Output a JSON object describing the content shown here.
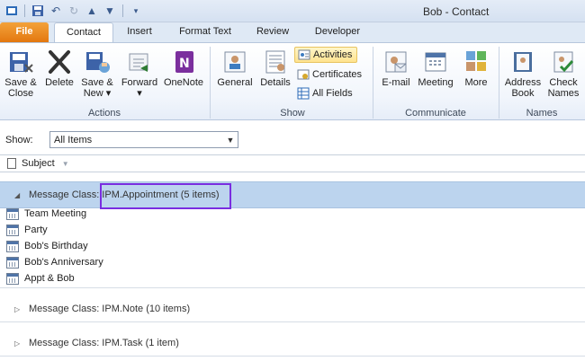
{
  "window": {
    "title": "Bob  -  Contact"
  },
  "tabs": [
    {
      "label": "File"
    },
    {
      "label": "Contact"
    },
    {
      "label": "Insert"
    },
    {
      "label": "Format Text"
    },
    {
      "label": "Review"
    },
    {
      "label": "Developer"
    }
  ],
  "ribbon": {
    "actions": {
      "save_close": [
        "Save &",
        "Close"
      ],
      "delete": "Delete",
      "save_new": [
        "Save &",
        "New ▾"
      ],
      "forward": "Forward ▾",
      "onenote": "OneNote",
      "group_label": "Actions"
    },
    "show": {
      "general": "General",
      "details": "Details",
      "activities": "Activities",
      "certificates": "Certificates",
      "all_fields": "All Fields",
      "group_label": "Show"
    },
    "communicate": {
      "email": "E-mail",
      "meeting": "Meeting",
      "more": "More",
      "group_label": "Communicate"
    },
    "names": {
      "address_book": [
        "Address",
        "Book"
      ],
      "check_names": [
        "Check",
        "Names"
      ],
      "group_label": "Names"
    }
  },
  "show_filter": {
    "label": "Show:",
    "selected": "All Items"
  },
  "columns": {
    "subject": "Subject"
  },
  "groups": [
    {
      "label": "Message Class: IPM.Appointment (5 items)",
      "expanded": true,
      "items": [
        "Team Meeting",
        "Party",
        "Bob's Birthday",
        "Bob's Anniversary",
        "Appt & Bob"
      ]
    },
    {
      "label": "Message Class: IPM.Note (10 items)",
      "expanded": false
    },
    {
      "label": "Message Class: IPM.Task (1 item)",
      "expanded": false
    }
  ],
  "colors": {
    "accent_file": "#e3770f",
    "selection": "#bcd4ee",
    "highlight_box": "#7a2de0"
  }
}
